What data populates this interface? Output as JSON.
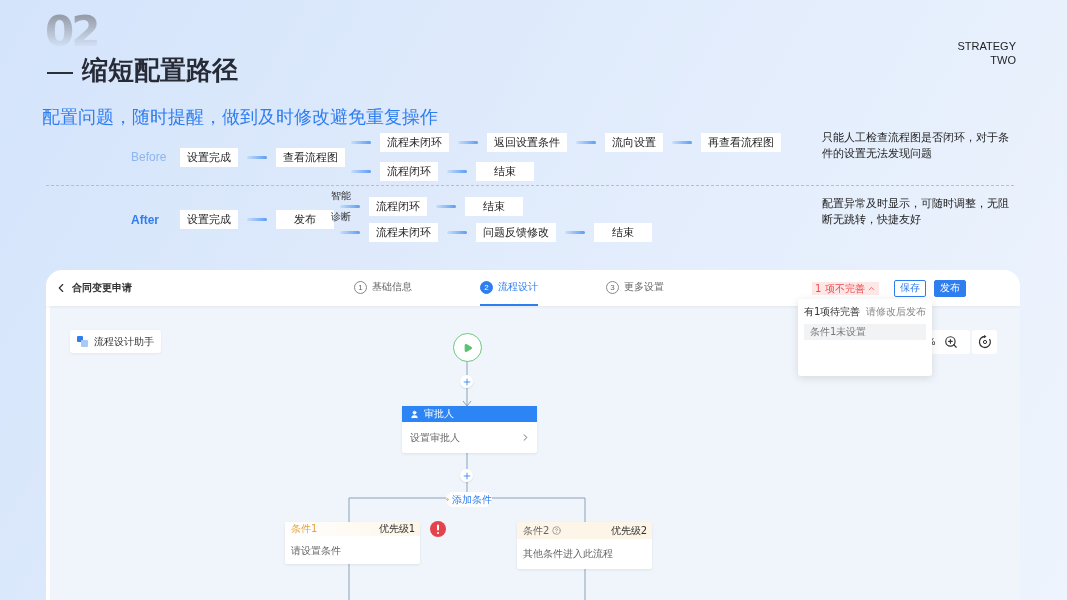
{
  "slide": {
    "number": "02",
    "title": "缩短配置路径",
    "subtitle": "配置问题，随时提醒，做到及时修改避免重复操作",
    "tag_lines": [
      "STRATEGY",
      "TWO"
    ]
  },
  "comparisons": [
    {
      "label": "Before",
      "kind": "before",
      "main": [
        "设置完成",
        "查看流程图"
      ],
      "branches": [
        [
          "流程未闭环",
          "返回设置条件",
          "流向设置",
          "再查看流程图"
        ],
        [
          "流程闭环",
          "结束"
        ]
      ],
      "note": "只能人工检查流程图是否闭环，对于条件的设置无法发现问题"
    },
    {
      "label": "After",
      "kind": "after",
      "main": [
        "设置完成",
        "发布"
      ],
      "branch_labels": [
        "智能",
        "诊断"
      ],
      "branches": [
        [
          "流程闭环",
          "结束"
        ],
        [
          "流程未闭环",
          "问题反馈修改",
          "结束"
        ]
      ],
      "note": "配置异常及时显示，可随时调整，无阻断无跳转，快捷友好"
    }
  ],
  "app": {
    "title": "合同变更申请",
    "steps": [
      {
        "number": "1",
        "label": "基础信息",
        "selected": false
      },
      {
        "number": "2",
        "label": "流程设计",
        "selected": true
      },
      {
        "number": "3",
        "label": "更多设置",
        "selected": false
      }
    ],
    "issue_badge": "1 项不完善",
    "buttons": [
      {
        "label": "保存",
        "kind": "secondary"
      },
      {
        "label": "发布",
        "kind": "primary"
      }
    ],
    "assistant": "流程设计助手",
    "zoom_reading": "%",
    "popover": {
      "title": "有1项待完善",
      "hint": "请修改后发布",
      "items": [
        "条件1未设置"
      ]
    },
    "flow": {
      "approver": {
        "title": "审批人",
        "value": "设置审批人"
      },
      "add_condition": "添加条件",
      "conditions": [
        {
          "name": "条件1",
          "priority": "优先级1",
          "text": "请设置条件",
          "error": true,
          "help": false
        },
        {
          "name": "条件2",
          "priority": "优先级2",
          "text": "其他条件进入此流程",
          "error": false,
          "help": true
        }
      ]
    }
  }
}
